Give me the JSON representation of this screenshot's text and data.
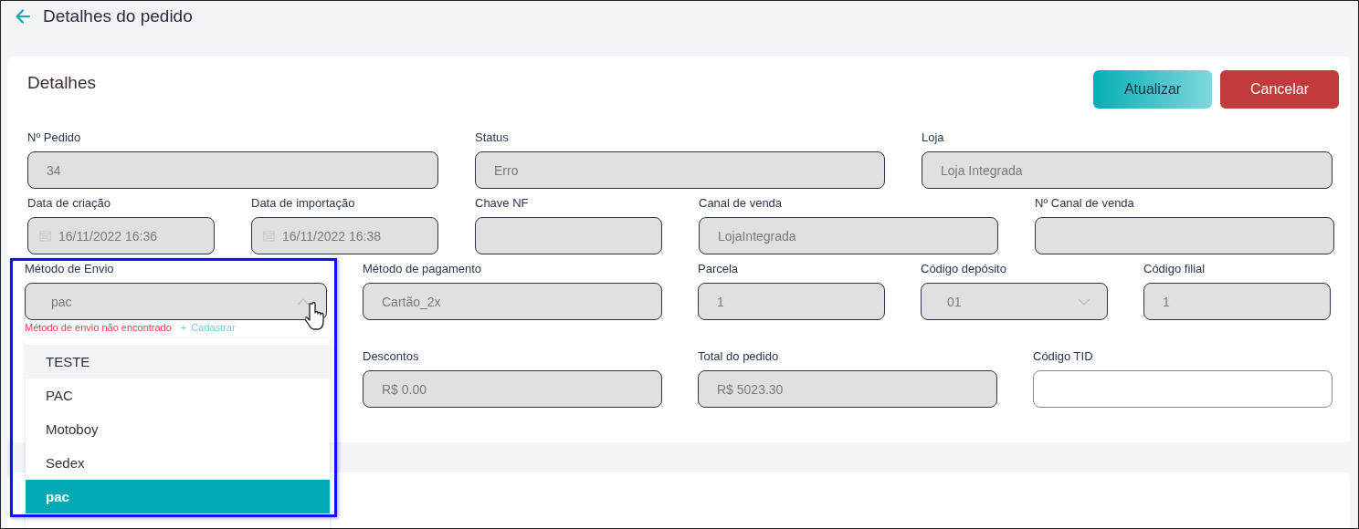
{
  "header": {
    "title": "Detalhes do pedido"
  },
  "card": {
    "title": "Detalhes",
    "buttons": [
      {
        "label": "Atualizar",
        "kind": "primary"
      },
      {
        "label": "Cancelar",
        "kind": "danger"
      }
    ]
  },
  "rows": [
    [
      {
        "label": "Nº Pedido",
        "value": "34",
        "kind": "text",
        "disabled": true
      },
      {
        "label": "Status",
        "value": "Erro",
        "kind": "text",
        "disabled": true
      },
      {
        "label": "Loja",
        "value": "Loja Integrada",
        "kind": "text",
        "disabled": true
      }
    ],
    [
      {
        "label": "Data de criação",
        "value": "16/11/2022 16:36",
        "kind": "date",
        "disabled": true
      },
      {
        "label": "Data de importação",
        "value": "16/11/2022 16:38",
        "kind": "date",
        "disabled": true
      },
      {
        "label": "Chave NF",
        "kind": "text",
        "disabled": true
      },
      {
        "label": "Canal de venda",
        "value": "LojaIntegrada",
        "kind": "text",
        "disabled": true
      },
      {
        "label": "Nº Canal de venda",
        "kind": "text",
        "disabled": true
      }
    ],
    [
      {
        "label": "Método de Envio",
        "value": "pac",
        "kind": "combobox",
        "disabled": true,
        "expanded": true,
        "error": "Método de envio não encontrado",
        "action_icon": "+",
        "action": "Cadastrar",
        "options": [
          {
            "label": "TESTE",
            "highlighted": true,
            "selected": false
          },
          {
            "label": "PAC",
            "highlighted": false,
            "selected": false
          },
          {
            "label": "Motoboy",
            "highlighted": false,
            "selected": false
          },
          {
            "label": "Sedex",
            "highlighted": false,
            "selected": false
          },
          {
            "label": "pac",
            "highlighted": false,
            "selected": true
          }
        ]
      },
      {
        "label": "Método de pagamento",
        "value": "Cartão_2x",
        "kind": "text",
        "disabled": true
      },
      {
        "label": "Parcela",
        "value": "1",
        "kind": "text",
        "disabled": true
      },
      {
        "label": "Código depósito",
        "value": "01",
        "kind": "select",
        "disabled": true
      },
      {
        "label": "Código filial",
        "value": "1",
        "kind": "text",
        "disabled": true
      }
    ],
    [
      {
        "label": "Descontos",
        "value": "R$ 0.00",
        "kind": "text",
        "disabled": true
      },
      {
        "label": "Total do pedido",
        "value": "R$ 5023.30",
        "kind": "text",
        "disabled": true
      },
      {
        "label": "Código TID",
        "kind": "text",
        "disabled": false
      }
    ]
  ]
}
